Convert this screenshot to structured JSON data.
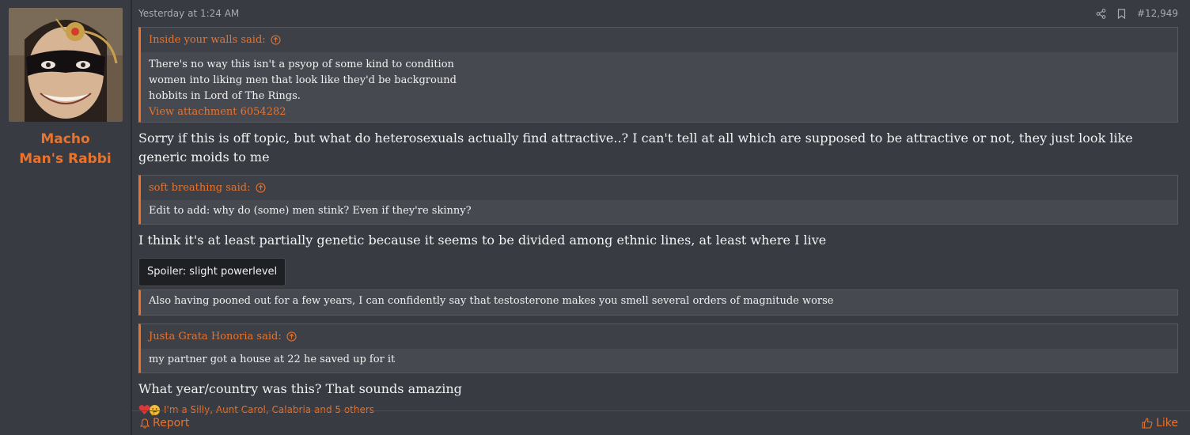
{
  "user": {
    "name": "Macho Man's Rabbi"
  },
  "post": {
    "timestamp": "Yesterday at 1:24 AM",
    "post_number": "#12,949",
    "quotes": [
      {
        "author_said": "Inside your walls said:",
        "lines": [
          "There's no way this isn't a psyop of some kind to condition",
          "women into liking men that look like they'd be background",
          "hobbits in Lord of The Rings."
        ],
        "attachment_link": "View attachment 6054282"
      },
      {
        "author_said": "soft breathing said:",
        "lines": [
          "Edit to add: why do (some) men stink? Even if they're skinny?"
        ]
      },
      {
        "lines": [
          "Also having pooned out for a few years, I can confidently say that testosterone makes you smell several orders of magnitude worse"
        ]
      },
      {
        "author_said": "Justa Grata Honoria said:",
        "lines": [
          "my partner got a house at 22 he saved up for it"
        ]
      }
    ],
    "messages": [
      "Sorry if this is off topic, but what do heterosexuals actually find attractive..? I can't tell at all which are supposed to be attractive or not, they just look like generic moids to me",
      "I think it's at least partially genetic because it seems to be divided among ethnic lines, at least where I live",
      "What year/country was this? That sounds amazing"
    ],
    "spoiler_label": "Spoiler: slight powerlevel",
    "reactions_text": "I'm a Silly, Aunt Carol, Calabria and 5 others"
  },
  "footer": {
    "report_label": "Report",
    "like_label": "Like"
  },
  "colors": {
    "accent": "#e8732e",
    "background": "#383b41",
    "quote_bg": "#464950"
  }
}
